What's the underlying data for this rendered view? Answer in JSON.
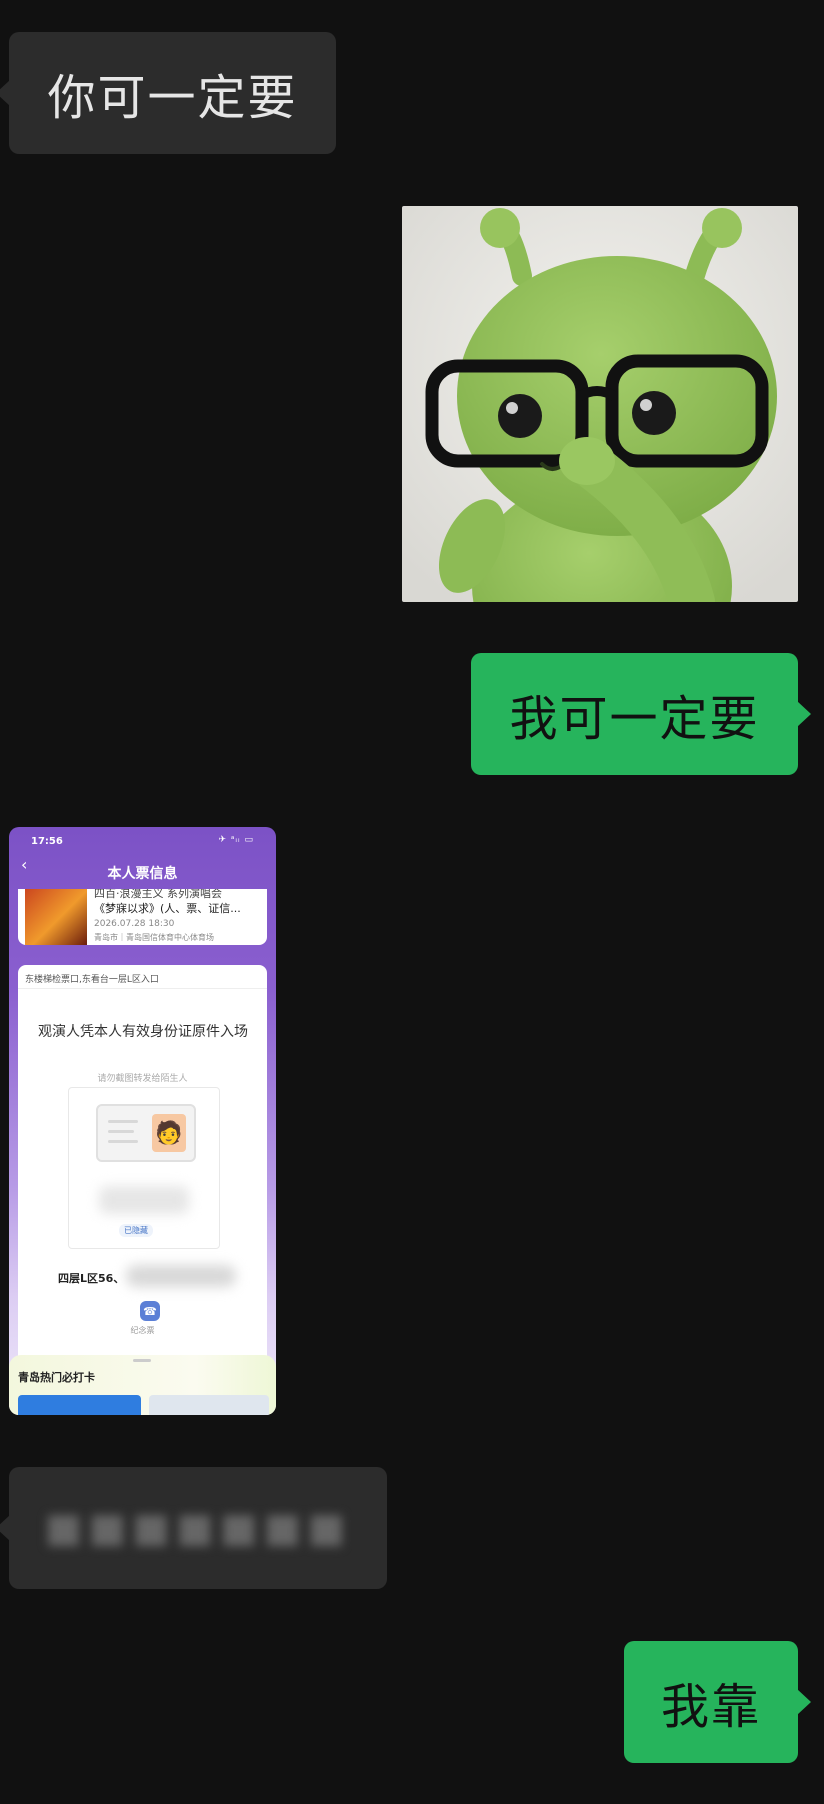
{
  "messages": [
    {
      "side": "left",
      "type": "text",
      "text": "你可一定要"
    },
    {
      "side": "right",
      "type": "sticker",
      "icon": "green-alien-with-glasses-sticker"
    },
    {
      "side": "right",
      "type": "text",
      "text": "我可一定要"
    },
    {
      "side": "left",
      "type": "image",
      "text": "ticket-screenshot"
    },
    {
      "side": "left",
      "type": "text-blurred",
      "text": ""
    },
    {
      "side": "right",
      "type": "text",
      "text": "我靠"
    }
  ],
  "ticket_screenshot": {
    "status_time": "17:56",
    "header_title": "本人票信息",
    "event_title_line1": "四百·浪漫主义 系列演唱会",
    "event_title_line2": "《梦寐以求》(人、票、证信...",
    "event_datetime": "2026.07.28 18:30",
    "event_venue": "青岛市｜青岛国信体育中心体育场",
    "gate": "东楼梯检票口,东看台一层L区入口",
    "notice": "观演人凭本人有效身份证原件入场",
    "hint": "请勿截图转发给陌生人",
    "hidden_tag": "已隐藏",
    "seat": "四层L区56、",
    "souvenir_label": "纪念票",
    "bottom_sheet_title": "青岛热门必打卡"
  },
  "colors": {
    "background": "#111111",
    "left_bubble": "#2c2c2c",
    "right_bubble": "#26b45c"
  }
}
